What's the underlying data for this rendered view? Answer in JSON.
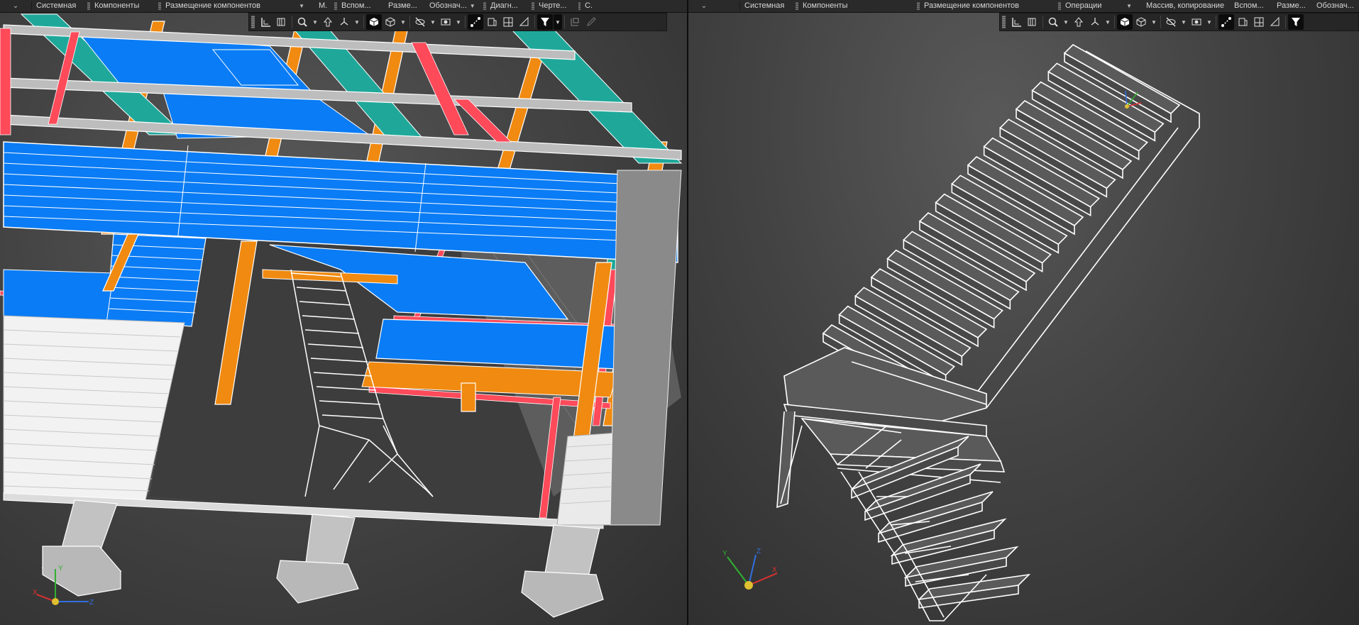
{
  "left_viewport": {
    "tabs": [
      {
        "label": "Системная"
      },
      {
        "label": "Компоненты"
      },
      {
        "label": "Размещение компонентов"
      },
      {
        "label": "М."
      },
      {
        "label": "Вспом..."
      },
      {
        "label": "Разме..."
      },
      {
        "label": "Обознач..."
      },
      {
        "label": "Диагн..."
      },
      {
        "label": "Черте..."
      },
      {
        "label": "С."
      }
    ],
    "axes": {
      "x": "X",
      "y": "Y",
      "z": "Z"
    }
  },
  "right_viewport": {
    "tabs": [
      {
        "label": "Системная"
      },
      {
        "label": "Компоненты"
      },
      {
        "label": "Размещение компонентов"
      },
      {
        "label": "Операции"
      },
      {
        "label": "Массив, копирование"
      },
      {
        "label": "Вспом..."
      },
      {
        "label": "Разме..."
      },
      {
        "label": "Обознач..."
      }
    ],
    "axes": {
      "x": "X",
      "y": "Y",
      "z": "Z"
    }
  },
  "colors": {
    "slab_blue": "#0a7cf5",
    "beam_orange": "#f08a10",
    "brace_teal": "#1fa89a",
    "member_red": "#ff4a5a",
    "wire_white": "#ffffff",
    "concrete_gray": "#bdbdbd",
    "axis_x": "#e03030",
    "axis_y": "#30b030",
    "axis_z": "#3070e0",
    "origin": "#e0c030"
  },
  "icons": [
    "collapse-chevron-icon",
    "layout-icon",
    "section-icon",
    "zoom-icon",
    "orient-icon",
    "axis-orient-icon",
    "shaded-cube-icon",
    "wireframe-cube-icon",
    "hide-icon",
    "view-display-icon",
    "filter-icon",
    "constraint-icon",
    "funnel-icon",
    "pipette-icon"
  ]
}
